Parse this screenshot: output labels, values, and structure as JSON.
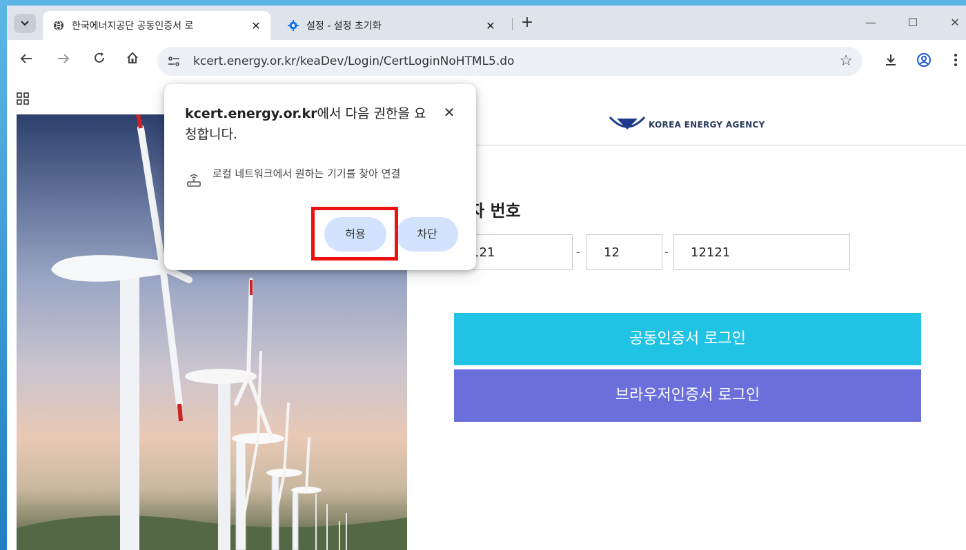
{
  "browser": {
    "tabs": [
      {
        "title": "한국에너지공단 공동인증서 로",
        "active": true,
        "favicon": "globe-icon"
      },
      {
        "title": "설정 - 설정 초기화",
        "active": false,
        "favicon": "gear-icon"
      }
    ],
    "url": "kcert.energy.or.kr/keaDev/Login/CertLoginNoHTML5.do"
  },
  "popup": {
    "domain": "kcert.energy.or.kr",
    "title_rest": "에서 다음 권한을 요청합니다.",
    "permission": "로컬 네트워크에서 원하는 기기를 찾아 연결",
    "allow_label": "허용",
    "block_label": "차단"
  },
  "page": {
    "agency_name": "KOREA ENERGY AGENCY",
    "biz_number_title": "업자 번호",
    "biz_number": {
      "part1": "121",
      "part2": "12",
      "part3": "12121"
    },
    "cert_login": "공동인증서 로그인",
    "browser_cert_login": "브라우저인증서 로그인"
  },
  "colors": {
    "cert_login_bg": "#20c3e4",
    "browser_cert_login_bg": "#6b6fdc",
    "popup_button_bg": "#d3e3fd",
    "highlight_border": "#ee1111"
  }
}
